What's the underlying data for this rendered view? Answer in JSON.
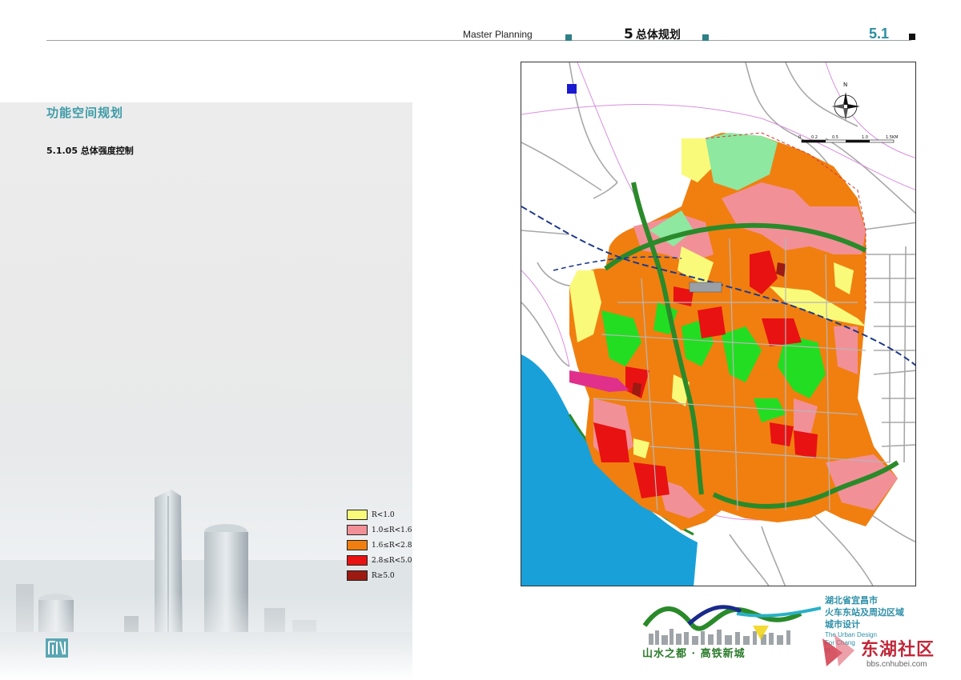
{
  "header": {
    "en_title": "Master Planning",
    "chapter_number": "5",
    "chapter_title": "总体规划",
    "page_number": "5.1",
    "accent_color": "#2e7f86"
  },
  "left_panel": {
    "section_title": "功能空间规划",
    "sub_title": "5.1.05 总体强度控制"
  },
  "legend": {
    "items": [
      {
        "label": "R<1.0",
        "color": "#fafa7a"
      },
      {
        "label": "1.0≤R<1.6",
        "color": "#f29098"
      },
      {
        "label": "1.6≤R<2.8",
        "color": "#f07f10"
      },
      {
        "label": "2.8≤R<5.0",
        "color": "#e81212"
      },
      {
        "label": "R≥5.0",
        "color": "#9c1a12"
      }
    ]
  },
  "map": {
    "north_label": "N",
    "scale_labels": [
      "0",
      "0.2",
      "0.5",
      "1.0",
      "1.5KM"
    ],
    "colors": {
      "river": "#1aa0d8",
      "green": "#22dd22",
      "dark_green": "#2a8a2a",
      "rail": "#1e3a8a",
      "road": "#9a9a9a",
      "magenta_line": "#d98fe0"
    }
  },
  "branding": {
    "slogan": "山水之都 · 高铁新城",
    "project_cn": [
      "湖北省宜昌市",
      "火车东站及周边区域",
      "城市设计"
    ],
    "project_en": [
      "The Urban Design",
      "For Chang",
      "Yi"
    ],
    "watermark_cn": "东湖社区",
    "watermark_url": "bbs.cnhubei.com"
  }
}
